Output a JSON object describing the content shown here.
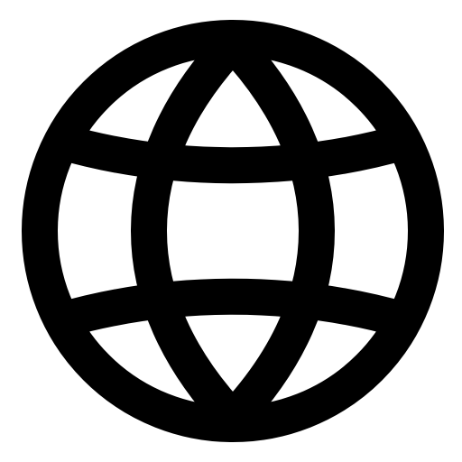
{
  "icon": {
    "name": "globe-icon",
    "color": "#000000",
    "background": "#ffffff"
  }
}
